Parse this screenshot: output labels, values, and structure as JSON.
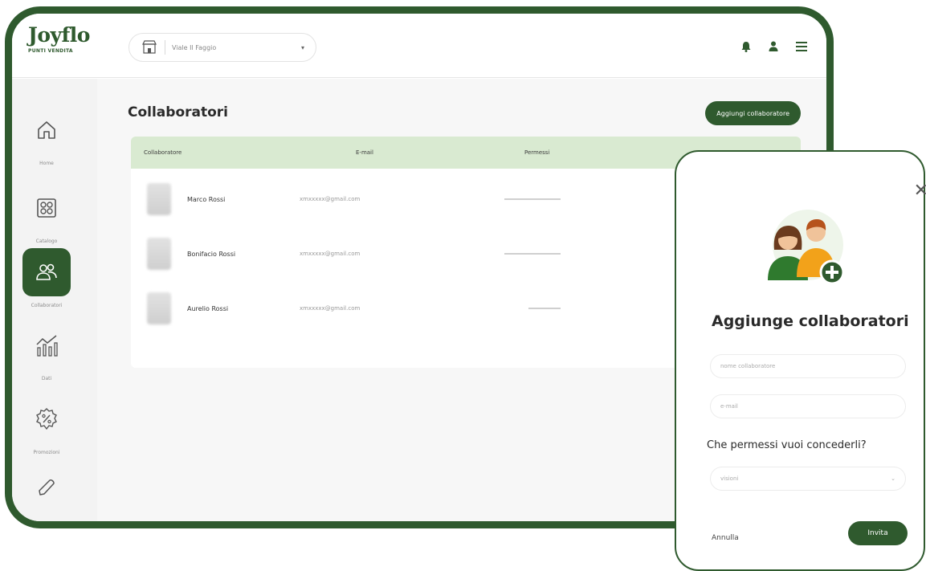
{
  "brand": {
    "name": "Joyflo",
    "tagline": "PUNTI VENDITA"
  },
  "store_selector": {
    "value": "Viale Il Faggio"
  },
  "topbar_icons": [
    "bell-icon",
    "user-icon",
    "menu-icon"
  ],
  "sidebar": {
    "items": [
      {
        "label": "Home",
        "icon": "home-icon"
      },
      {
        "label": "Catalogo",
        "icon": "catalog-icon"
      },
      {
        "label": "Collaboratori",
        "icon": "users-icon",
        "active": true
      },
      {
        "label": "Dati",
        "icon": "stats-icon"
      },
      {
        "label": "Promozioni",
        "icon": "percent-icon"
      },
      {
        "label": "",
        "icon": "pen-icon"
      }
    ]
  },
  "page": {
    "title": "Collaboratori",
    "add_button": "Aggiungi collaboratore"
  },
  "table": {
    "columns": [
      "Collaboratore",
      "E-mail",
      "Permessi"
    ],
    "rows": [
      {
        "name": "Marco Rossi",
        "email": "xmxxxxx@gmail.com"
      },
      {
        "name": "Bonifacio Rossi",
        "email": "xmxxxxx@gmail.com"
      },
      {
        "name": "Aurelio Rossi",
        "email": "xmxxxxx@gmail.com"
      }
    ]
  },
  "modal": {
    "title": "Aggiunge collaboratori",
    "name_placeholder": "nome collaboratore",
    "email_placeholder": "e-mail",
    "permissions_question": "Che permessi vuoi concederli?",
    "permissions_value": "visioni",
    "cancel": "Annulla",
    "invite": "Invita"
  },
  "colors": {
    "brand_green": "#2f5a2e",
    "header_green": "#d9ead1"
  }
}
